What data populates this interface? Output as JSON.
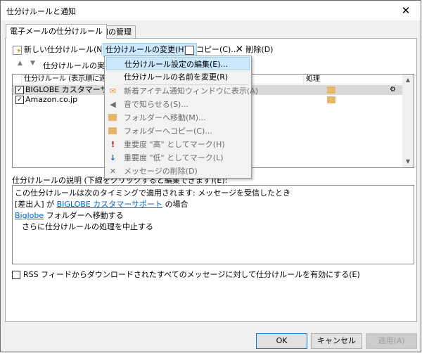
{
  "window": {
    "title": "仕分けルールと通知"
  },
  "tabs": [
    {
      "label": "電子メールの仕分けルール"
    },
    {
      "label": "通知の管理"
    }
  ],
  "toolbar": {
    "new_rule": "新しい仕分けルール(N)...",
    "change_rule": "仕分けルールの変更(H)",
    "copy": "コピー(C)...",
    "delete": "削除(D)"
  },
  "run_rules": "仕分けルールの実行(R",
  "rules_list": {
    "header_rule": "仕分けルール (表示順に適用",
    "header_action": "処理",
    "rows": [
      {
        "name": "BIGLOBE カスタマーサポート",
        "checked": true
      },
      {
        "name": "Amazon.co.jp",
        "checked": true
      }
    ]
  },
  "menu": {
    "items": [
      {
        "label": "仕分けルール設定の編集(E)...",
        "icon": ""
      },
      {
        "label": "仕分けルールの名前を変更(R)",
        "icon": ""
      },
      {
        "label": "新着アイテム通知ウィンドウに表示(A)",
        "icon": "envelope-icon"
      },
      {
        "label": "音で知らせる(S)...",
        "icon": "speaker-icon"
      },
      {
        "label": "フォルダーへ移動(M)...",
        "icon": "folder-move-icon"
      },
      {
        "label": "フォルダーへコピー(C)...",
        "icon": "folder-copy-icon"
      },
      {
        "label": "重要度 \"高\" としてマーク(H)",
        "icon": "exclamation-icon"
      },
      {
        "label": "重要度 \"低\" としてマーク(L)",
        "icon": "down-arrow-icon"
      },
      {
        "label": "メッセージの削除(D)",
        "icon": "delete-x-icon"
      }
    ]
  },
  "description": {
    "label": "仕分けルールの説明 (下線をクリックすると編集できます)(E):",
    "line1": "この仕分けルールは次のタイミングで適用されます: メッセージを受信したとき",
    "line2_prefix": "[差出人] が ",
    "line2_link": "BIGLOBE カスタマーサポート",
    "line2_suffix": " の場合",
    "line3_link": "Biglobe",
    "line3_suffix": " フォルダーへ移動する",
    "line4": "さらに仕分けルールの処理を中止する"
  },
  "rss_option": "RSS フィードからダウンロードされたすべてのメッセージに対して仕分けルールを有効にする(E)",
  "buttons": {
    "ok": "OK",
    "cancel": "キャンセル",
    "apply": "適用(A)"
  },
  "colors": {
    "highlight": "#cce8ff",
    "link": "#0066cc",
    "folder": "#e8b56a"
  }
}
